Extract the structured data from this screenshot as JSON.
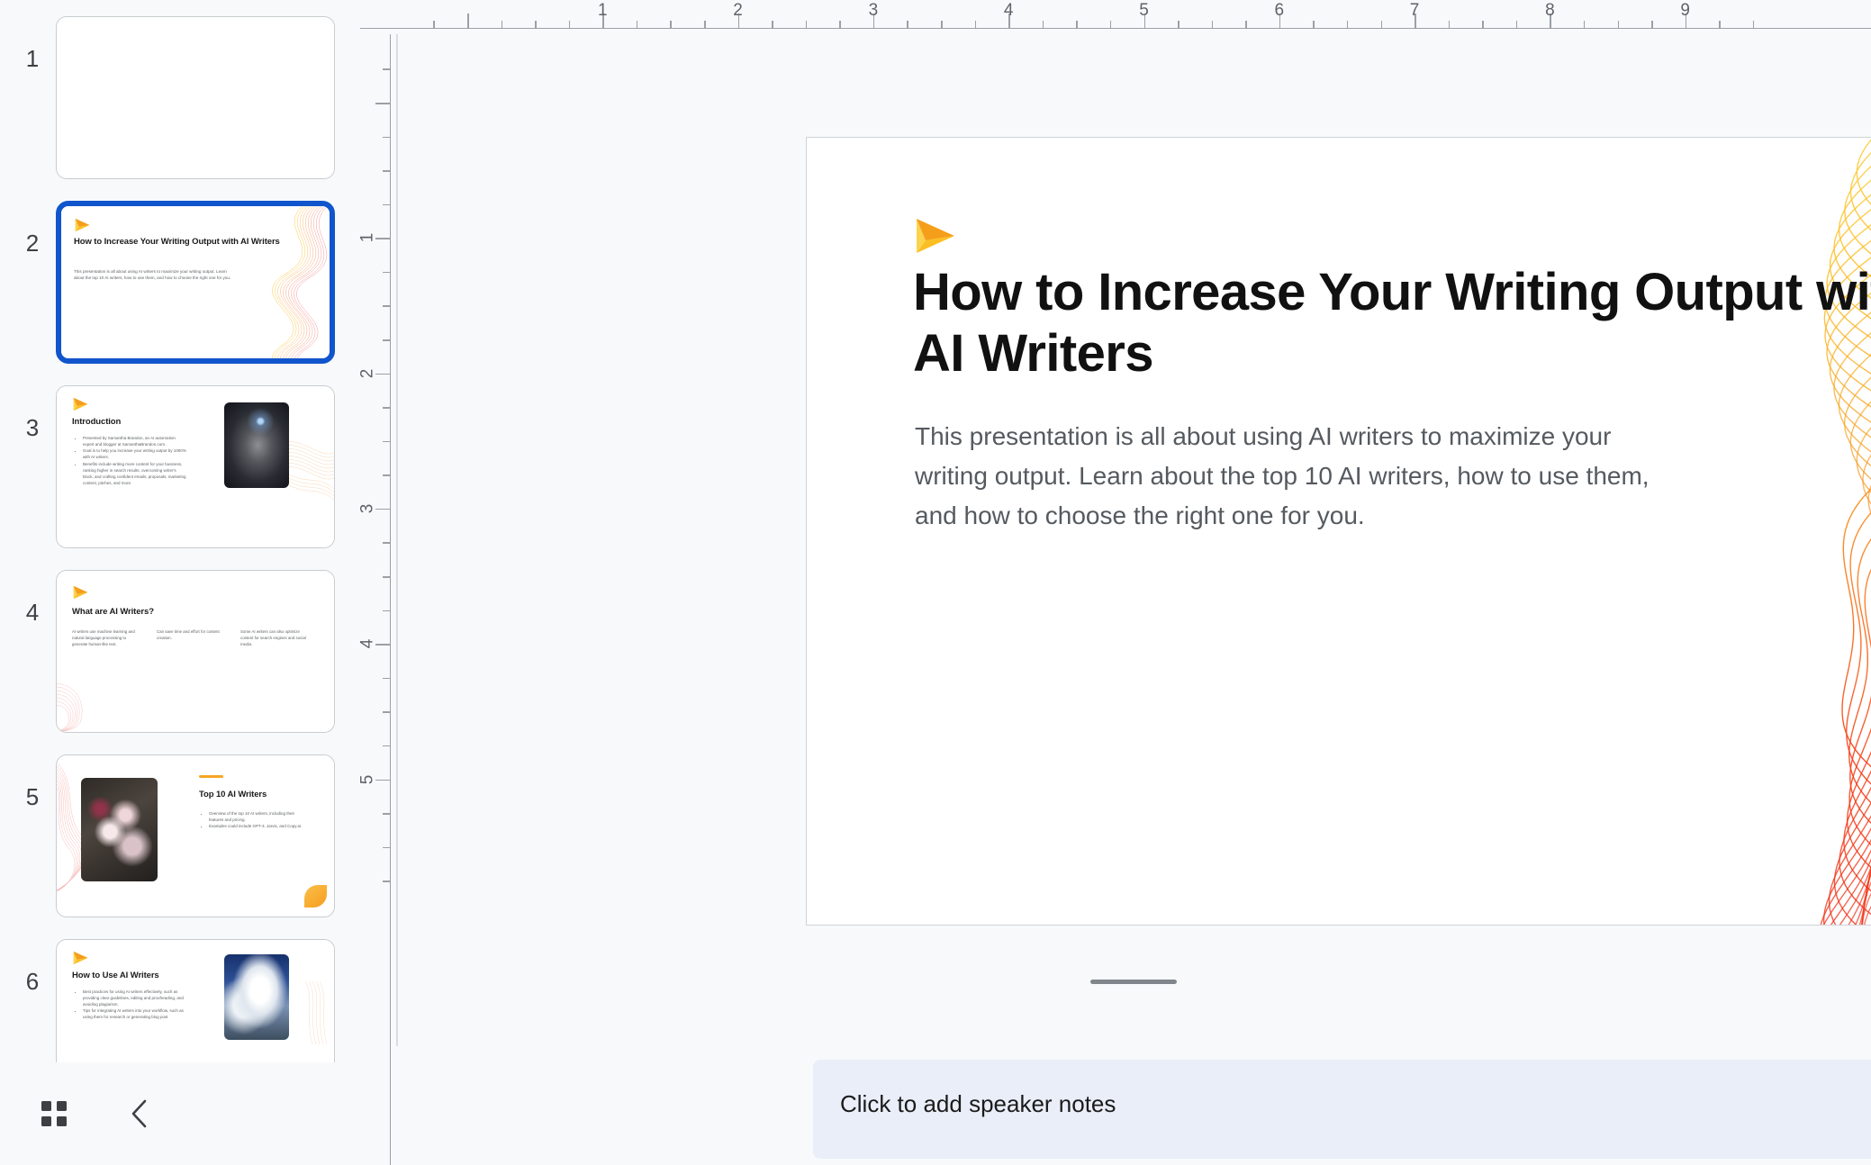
{
  "app": {
    "accent_blue": "#1155cc",
    "brand_orange": "#f59e1b",
    "notes_bg": "#e9eef8"
  },
  "filmstrip": {
    "scrollbar": {
      "name": "thumbnail-scrollbar"
    },
    "toolbar": {
      "grid_view_label": "grid-view-icon",
      "collapse_label": "collapse-filmstrip-icon"
    },
    "slides": [
      {
        "number": "1",
        "selected": false,
        "layout": "blank",
        "title": "",
        "body": "",
        "bullets": [],
        "columns": []
      },
      {
        "number": "2",
        "selected": true,
        "layout": "title",
        "title": "How to Increase Your Writing Output with AI Writers",
        "body": "This presentation is all about using AI writers to maximize your writing output. Learn about the top 10 AI writers, how to use them, and how to choose the right one for you.",
        "bullets": [],
        "columns": []
      },
      {
        "number": "3",
        "selected": false,
        "layout": "bullets-image",
        "title": "Introduction",
        "body": "",
        "bullets": [
          "Presented by Samantha Brandon, an AI automation expert and blogger at SamanthaBrandon.com.",
          "Goal is to help you increase your writing output by 1000% with AI writers.",
          "Benefits include writing more content for your business, ranking higher in search results, overcoming writer's block, and crafting confident emails, proposals, marketing content, pitches, and more."
        ],
        "columns": [],
        "image": "robot-image"
      },
      {
        "number": "4",
        "selected": false,
        "layout": "three-column",
        "title": "What are AI Writers?",
        "body": "",
        "bullets": [],
        "columns": [
          "AI writers use machine learning and natural language processing to generate human-like text.",
          "Can save time and effort for content creation.",
          "Some AI writers can also optimize content for search engines and social media."
        ]
      },
      {
        "number": "5",
        "selected": false,
        "layout": "image-bullets",
        "title": "Top 10 AI Writers",
        "body": "",
        "bullets": [
          "Overview of the top 10 AI writers, including their features and pricing.",
          "Examples could include GPT-3, Jarvis, and Copy.ai."
        ],
        "columns": [],
        "image": "flower-image"
      },
      {
        "number": "6",
        "selected": false,
        "layout": "bullets-image",
        "title": "How to Use AI Writers",
        "body": "",
        "bullets": [
          "Best practices for using AI writers effectively, such as providing clear guidelines, editing and proofreading, and avoiding plagiarism.",
          "Tips for integrating AI writers into your workflow, such as using them for research or generating blog post"
        ],
        "columns": [],
        "image": "cloud-image"
      }
    ]
  },
  "rulers": {
    "horizontal_numbers": [
      "1",
      "2",
      "3",
      "4",
      "5",
      "6",
      "7",
      "8",
      "9"
    ],
    "vertical_numbers": [
      "1",
      "2",
      "3",
      "4",
      "5"
    ],
    "unit": "inch"
  },
  "slide": {
    "logo": "play-triangle-logo",
    "title": "How to Increase Your Writing Output with AI Writers",
    "body": "This presentation is all about using AI writers to maximize your writing output. Learn about the top 10 AI writers, how to use them, and how to choose the right one for you.",
    "decoration": "orange-wave-lines"
  },
  "notes": {
    "placeholder": "Click to add speaker notes"
  }
}
